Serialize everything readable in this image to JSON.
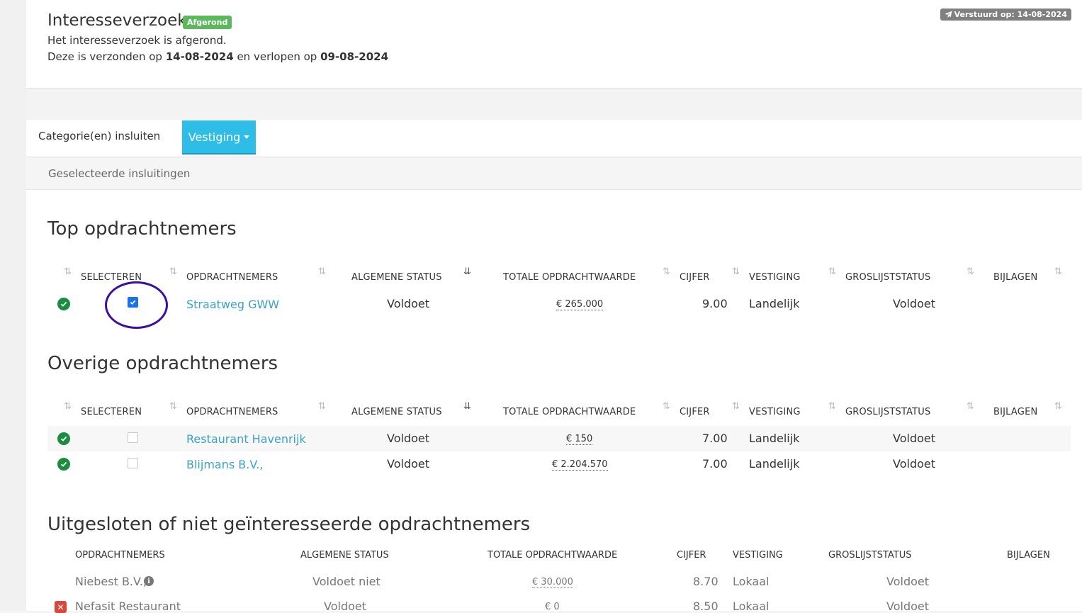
{
  "header": {
    "title": "Interesseverzoek",
    "status_badge": "Afgerond",
    "message": "Het interesseverzoek is afgerond.",
    "sent_prefix": "Deze is verzonden op ",
    "sent_date": "14-08-2024",
    "expire_middle": " en verlopen op ",
    "expire_date": "09-08-2024",
    "sent_label": "Verstuurd op: 14-08-2024"
  },
  "tabs": {
    "include_categories": "Categorie(en) insluiten",
    "location": "Vestiging"
  },
  "selected_inclusions": "Geselecteerde insluitingen",
  "columns": {
    "select": "SELECTEREN",
    "contractors": "OPDRACHTNEMERS",
    "general_status": "ALGEMENE STATUS",
    "total_value": "TOTALE OPDRACHTWAARDE",
    "grade": "CIJFER",
    "location": "VESTIGING",
    "shortlist_status": "GROSLIJSTSTATUS",
    "attachments": "BIJLAGEN"
  },
  "top": {
    "heading": "Top opdrachtnemers",
    "rows": [
      {
        "name": "Straatweg GWW",
        "status": "Voldoet",
        "value": "€ 265.000",
        "grade": "9.00",
        "location": "Landelijk",
        "shortlist": "Voldoet",
        "selected": true
      }
    ]
  },
  "other": {
    "heading": "Overige opdrachtnemers",
    "rows": [
      {
        "name": "Restaurant Havenrijk",
        "status": "Voldoet",
        "value": "€ 150",
        "grade": "7.00",
        "location": "Landelijk",
        "shortlist": "Voldoet",
        "selected": false
      },
      {
        "name": "Blijmans B.V.,",
        "status": "Voldoet",
        "value": "€ 2.204.570",
        "grade": "7.00",
        "location": "Landelijk",
        "shortlist": "Voldoet",
        "selected": false
      }
    ]
  },
  "excluded": {
    "heading": "Uitgesloten of niet geïnteresseerde opdrachtnemers",
    "columns": {
      "contractors": "OPDRACHTNEMERS",
      "general_status": "ALGEMENE STATUS",
      "total_value": "TOTALE OPDRACHTWAARDE",
      "grade": "CIJFER",
      "location": "VESTIGING",
      "shortlist_status": "GROSLIJSTSTATUS",
      "attachments": "BIJLAGEN"
    },
    "rows": [
      {
        "name": "Niebest B.V.,",
        "status": "Voldoet niet",
        "value": "€ 30.000",
        "grade": "8.70",
        "location": "Lokaal",
        "shortlist": "Voldoet"
      },
      {
        "name": "Nefasit Restaurant",
        "status": "Voldoet",
        "value": "€ 0",
        "grade": "8.50",
        "location": "Lokaal",
        "shortlist": "Voldoet"
      }
    ]
  },
  "icons": {
    "ok": "check-circle-icon",
    "sort": "sort-icon",
    "sent": "paper-plane-icon",
    "info": "info-icon",
    "excluded": "close-icon"
  },
  "colors": {
    "accent": "#2dbde6",
    "success": "#5cb85c",
    "link": "#3aa3c7",
    "danger": "#d9473a",
    "annotation": "#3b0fa0"
  }
}
